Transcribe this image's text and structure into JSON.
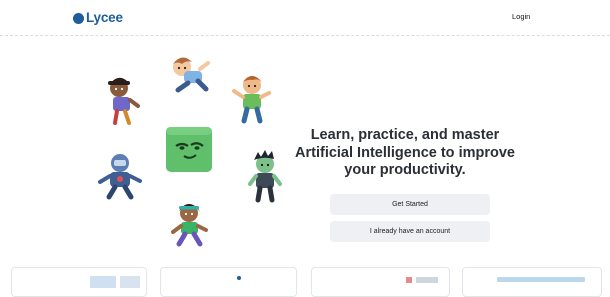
{
  "app": {
    "logo_text": "Lycee"
  },
  "header": {
    "login_label": "Login"
  },
  "hero": {
    "headline": "Learn, practice, and master Artificial Intelligence to improve your productivity.",
    "get_started_label": "Get Started",
    "have_account_label": "I already have an account"
  },
  "colors": {
    "brand": "#1e5e9c",
    "button_bg": "#eef0f3",
    "mascot_green": "#5fbf6a"
  },
  "icons": [
    "logo-dot-icon",
    "mascot-character"
  ]
}
